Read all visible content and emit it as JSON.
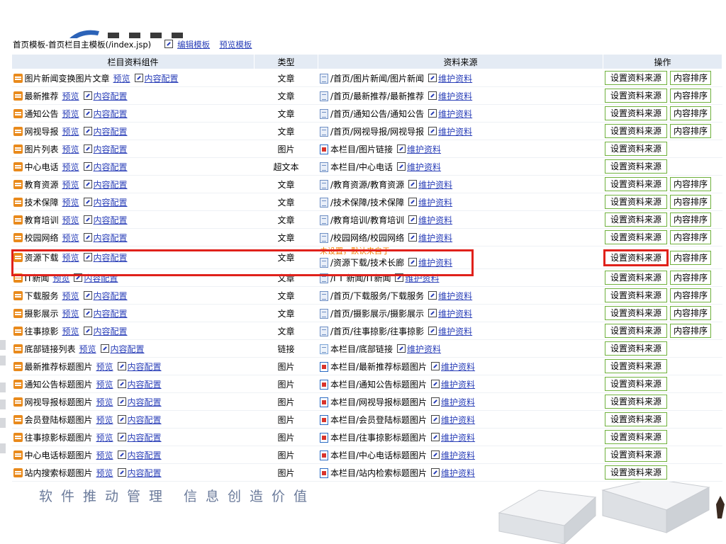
{
  "header": {
    "title": "首页模板-首页栏目主模板(/index.jsp)",
    "edit_template": "编辑模板",
    "preview_template": "预览模板"
  },
  "columns": {
    "component": "栏目资料组件",
    "type": "类型",
    "source": "资料来源",
    "ops": "操作"
  },
  "labels": {
    "preview": "预览",
    "content_config": "内容配置",
    "maintain": "维护资料",
    "set_source": "设置资料来源",
    "sort": "内容排序"
  },
  "background": {
    "slogan": "软件推动管理 信息创造价值"
  },
  "colors": {
    "header_bg": "#e4ebf4",
    "highlight": "#e0211b",
    "note": "#f07a00",
    "button_border": "#6fb13c",
    "link": "#2a3fb8"
  },
  "rows": [
    {
      "name": "图片新闻变换图片文章",
      "type": "文章",
      "source": "/首页/图片新闻/图片新闻",
      "icon": "article",
      "sort": true
    },
    {
      "name": "最新推荐",
      "type": "文章",
      "source": "/首页/最新推荐/最新推荐",
      "icon": "article",
      "sort": true
    },
    {
      "name": "通知公告",
      "type": "文章",
      "source": "/首页/通知公告/通知公告",
      "icon": "article",
      "sort": true
    },
    {
      "name": "网视导报",
      "type": "文章",
      "source": "/首页/网视导报/网视导报",
      "icon": "article",
      "sort": true
    },
    {
      "name": "图片列表",
      "type": "图片",
      "source": "本栏目/图片链接",
      "icon": "picture",
      "sort": false
    },
    {
      "name": "中心电话",
      "type": "超文本",
      "source": "本栏目/中心电话",
      "icon": "article",
      "sort": false
    },
    {
      "name": "教育资源",
      "type": "文章",
      "source": "/教育资源/教育资源",
      "icon": "article",
      "sort": true
    },
    {
      "name": "技术保障",
      "type": "文章",
      "source": "/技术保障/技术保障",
      "icon": "article",
      "sort": true
    },
    {
      "name": "教育培训",
      "type": "文章",
      "source": "/教育培训/教育培训",
      "icon": "article",
      "sort": true
    },
    {
      "name": "校园网络",
      "type": "文章",
      "source": "/校园网络/校园网络",
      "icon": "article",
      "sort": true
    },
    {
      "name": "资源下载",
      "type": "文章",
      "source": "/资源下载/技术长廊",
      "icon": "article",
      "sort": true,
      "note": "未设置，默认来自于",
      "highlight": true
    },
    {
      "name": "IT新闻",
      "type": "文章",
      "source": "/I T 新闻/IT新闻",
      "icon": "article",
      "sort": true
    },
    {
      "name": "下载服务",
      "type": "文章",
      "source": "/首页/下载服务/下载服务",
      "icon": "article",
      "sort": true
    },
    {
      "name": "摄影展示",
      "type": "文章",
      "source": "/首页/摄影展示/摄影展示",
      "icon": "article",
      "sort": true
    },
    {
      "name": "往事掠影",
      "type": "文章",
      "source": "/首页/往事掠影/往事掠影",
      "icon": "article",
      "sort": true
    },
    {
      "name": "底部链接列表",
      "type": "链接",
      "source": "本栏目/底部链接",
      "icon": "link",
      "sort": false
    },
    {
      "name": "最新推荐标题图片",
      "type": "图片",
      "source": "本栏目/最新推荐标题图片",
      "icon": "picture",
      "sort": false
    },
    {
      "name": "通知公告标题图片",
      "type": "图片",
      "source": "本栏目/通知公告标题图片",
      "icon": "picture",
      "sort": false
    },
    {
      "name": "网视导报标题图片",
      "type": "图片",
      "source": "本栏目/网视导报标题图片",
      "icon": "picture",
      "sort": false
    },
    {
      "name": "会员登陆标题图片",
      "type": "图片",
      "source": "本栏目/会员登陆标题图片",
      "icon": "picture",
      "sort": false
    },
    {
      "name": "往事掠影标题图片",
      "type": "图片",
      "source": "本栏目/往事掠影标题图片",
      "icon": "picture",
      "sort": false
    },
    {
      "name": "中心电话标题图片",
      "type": "图片",
      "source": "本栏目/中心电话标题图片",
      "icon": "picture",
      "sort": false
    },
    {
      "name": "站内搜索标题图片",
      "type": "图片",
      "source": "本栏目/站内检索标题图片",
      "icon": "picture",
      "sort": false
    }
  ]
}
